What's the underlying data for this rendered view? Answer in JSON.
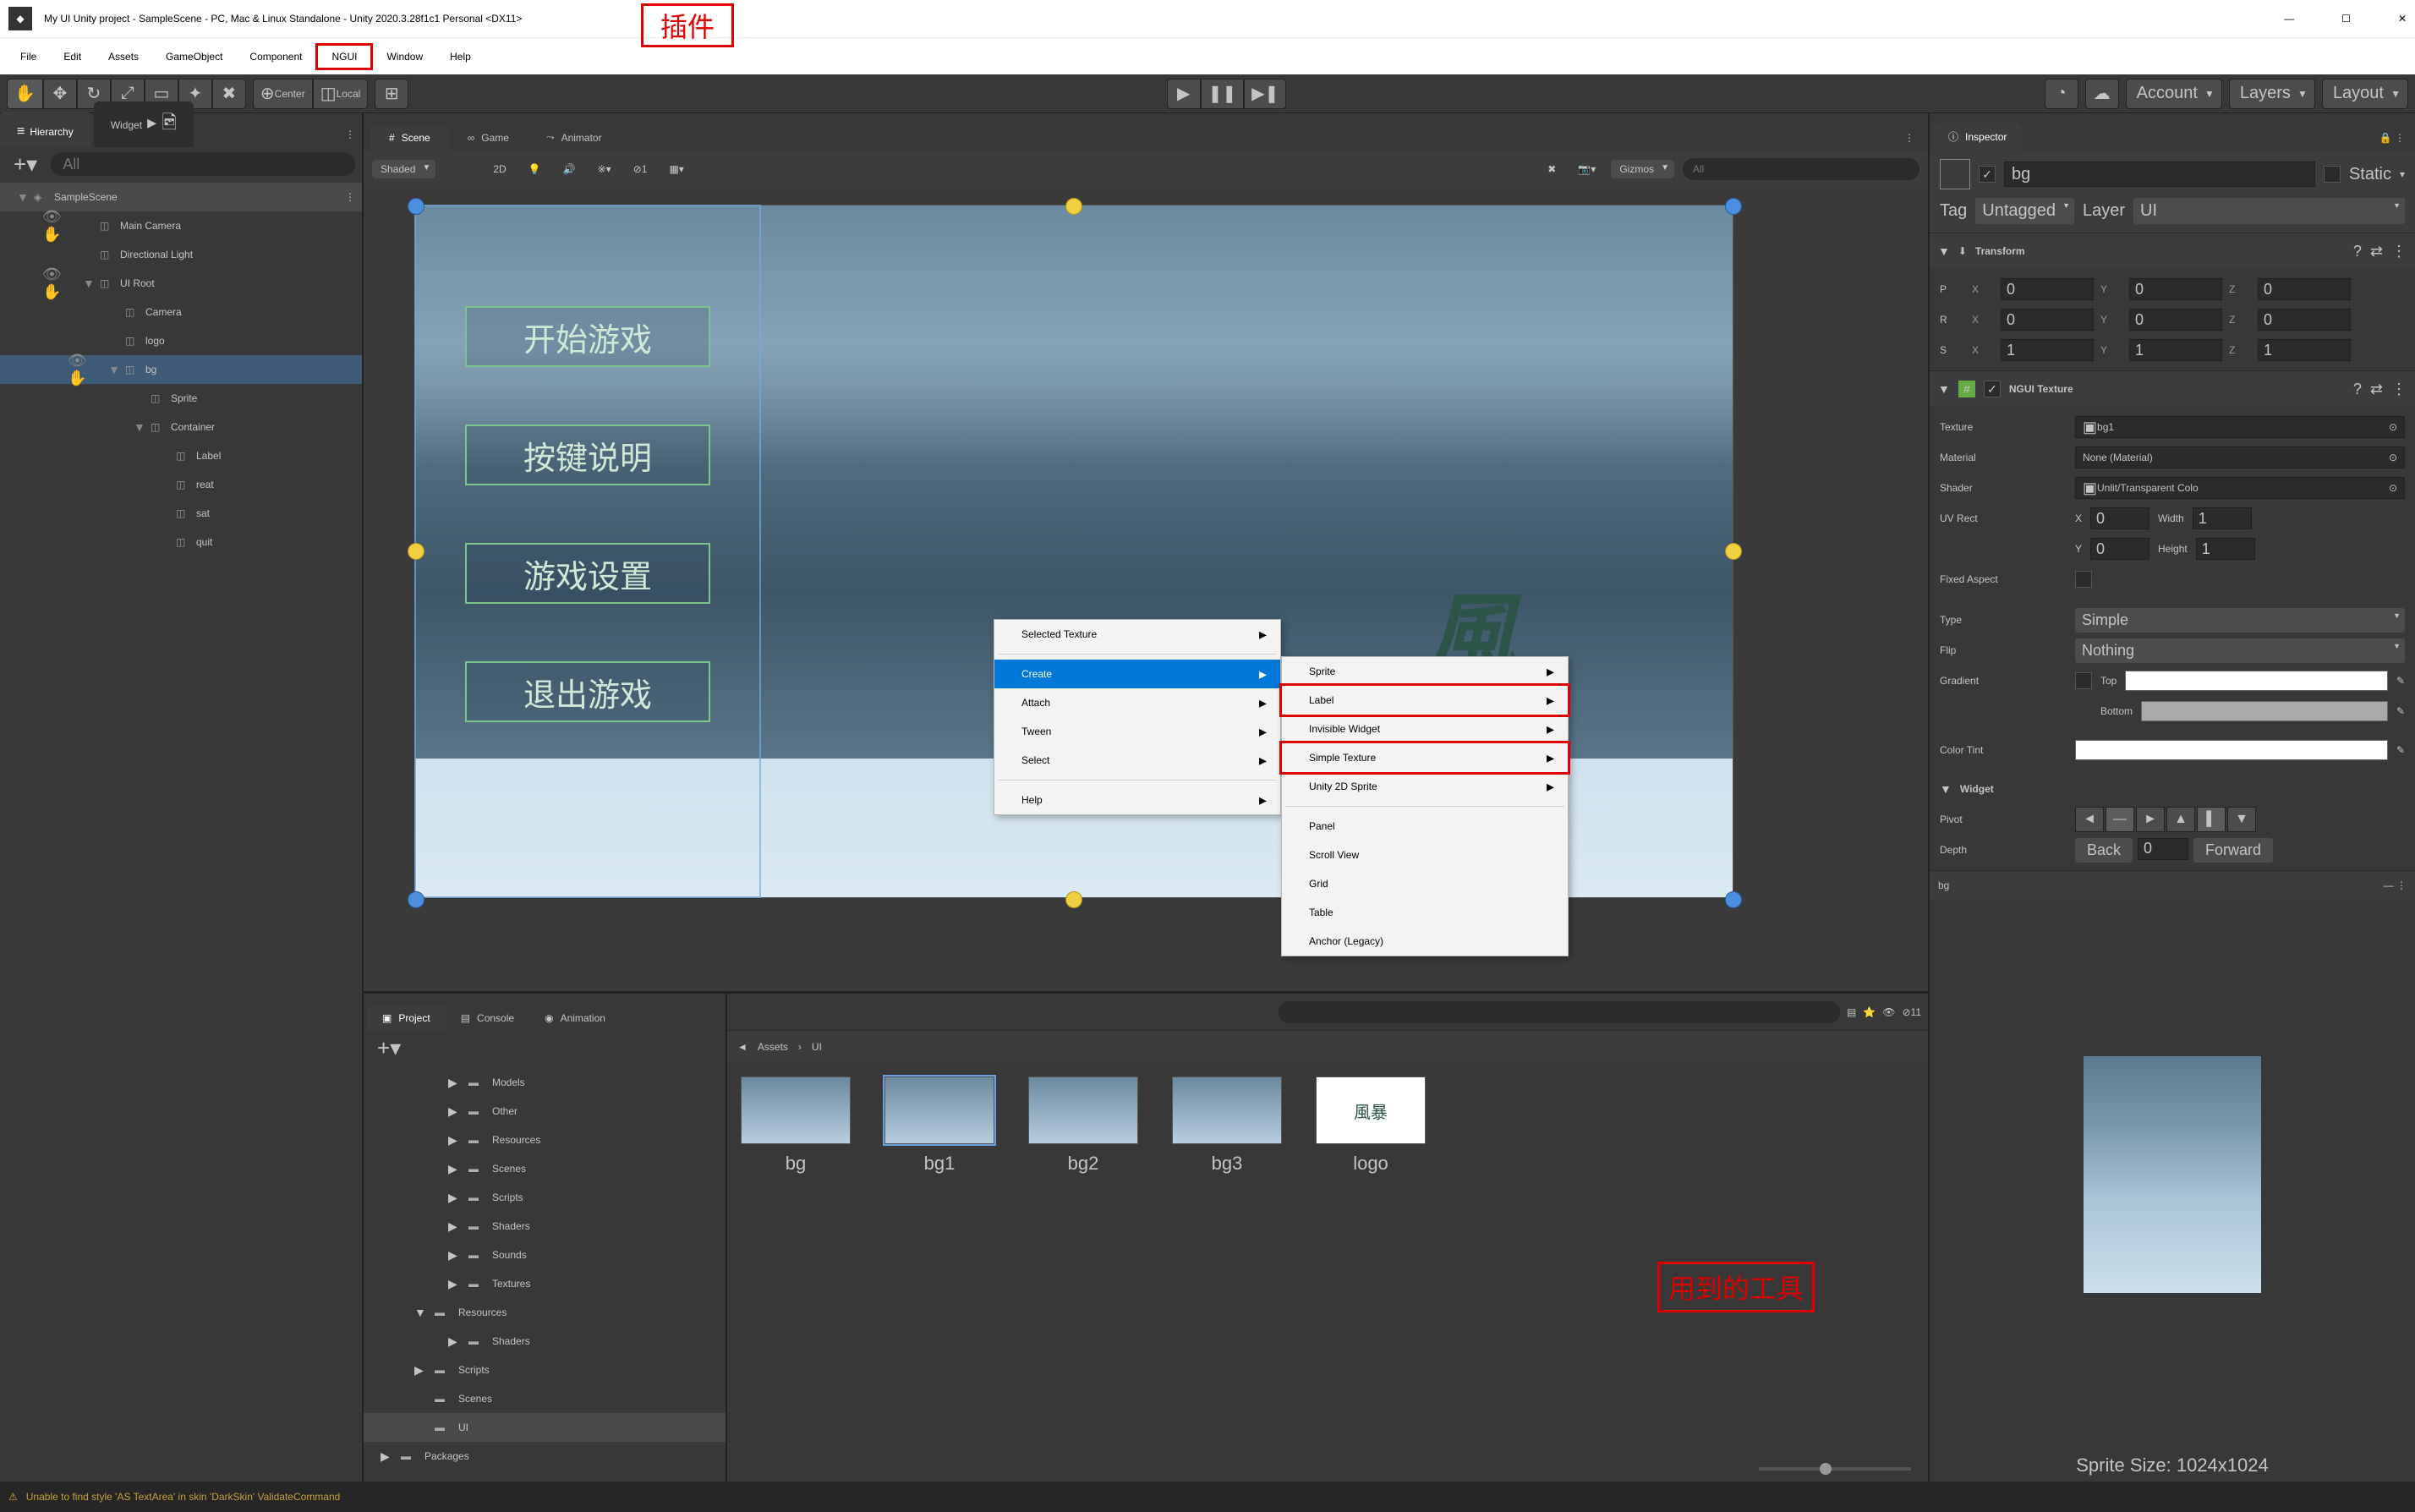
{
  "title": "My UI Unity project - SampleScene - PC, Mac & Linux Standalone - Unity 2020.3.28f1c1 Personal <DX11>",
  "annotation_top": "插件",
  "menubar": [
    "File",
    "Edit",
    "Assets",
    "GameObject",
    "Component",
    "NGUI",
    "Window",
    "Help"
  ],
  "menubar_highlight": "NGUI",
  "toolbar": {
    "center": "Center",
    "local": "Local",
    "account": "Account",
    "layers": "Layers",
    "layout": "Layout"
  },
  "hierarchy": {
    "title": "Hierarchy",
    "widget_tab": "Widget",
    "search_placeholder": "All",
    "scene": "SampleScene",
    "nodes": [
      {
        "name": "Main Camera",
        "ind": 1
      },
      {
        "name": "Directional Light",
        "ind": 1
      },
      {
        "name": "UI Root",
        "ind": 1,
        "exp": true
      },
      {
        "name": "Camera",
        "ind": 2
      },
      {
        "name": "logo",
        "ind": 2
      },
      {
        "name": "bg",
        "ind": 2,
        "exp": true,
        "sel": true
      },
      {
        "name": "Sprite",
        "ind": 3
      },
      {
        "name": "Container",
        "ind": 3,
        "exp": true
      },
      {
        "name": "Label",
        "ind": 4
      },
      {
        "name": "reat",
        "ind": 4
      },
      {
        "name": "sat",
        "ind": 4
      },
      {
        "name": "quit",
        "ind": 4
      }
    ]
  },
  "scene_tabs": {
    "scene": "Scene",
    "game": "Game",
    "animator": "Animator"
  },
  "scene_toolbar": {
    "shaded": "Shaded",
    "twod": "2D",
    "gizmos": "Gizmos",
    "search_placeholder": "All"
  },
  "menu_buttons": [
    "开始游戏",
    "按键说明",
    "游戏设置",
    "退出游戏"
  ],
  "context1": [
    {
      "label": "Selected Texture",
      "arrow": true
    },
    {
      "sep": true
    },
    {
      "label": "Create",
      "arrow": true,
      "sel": true
    },
    {
      "label": "Attach",
      "arrow": true
    },
    {
      "label": "Tween",
      "arrow": true
    },
    {
      "label": "Select",
      "arrow": true
    },
    {
      "sep": true
    },
    {
      "label": "Help",
      "arrow": true
    }
  ],
  "context2": [
    {
      "label": "Sprite",
      "arrow": true
    },
    {
      "label": "Label",
      "arrow": true,
      "hl": true
    },
    {
      "label": "Invisible Widget",
      "arrow": true
    },
    {
      "label": "Simple Texture",
      "arrow": true,
      "hl": true
    },
    {
      "label": "Unity 2D Sprite",
      "arrow": true
    },
    {
      "sep": true
    },
    {
      "label": "Panel"
    },
    {
      "label": "Scroll View"
    },
    {
      "label": "Grid"
    },
    {
      "label": "Table"
    },
    {
      "label": "Anchor (Legacy)"
    }
  ],
  "annotation_tools": "用到的工具",
  "project": {
    "tab_project": "Project",
    "tab_console": "Console",
    "tab_animation": "Animation",
    "tree": [
      {
        "name": "Models",
        "ind": 2,
        "tri": "▶"
      },
      {
        "name": "Other",
        "ind": 2,
        "tri": "▶"
      },
      {
        "name": "Resources",
        "ind": 2,
        "tri": "▶"
      },
      {
        "name": "Scenes",
        "ind": 2,
        "tri": "▶"
      },
      {
        "name": "Scripts",
        "ind": 2,
        "tri": "▶"
      },
      {
        "name": "Shaders",
        "ind": 2,
        "tri": "▶"
      },
      {
        "name": "Sounds",
        "ind": 2,
        "tri": "▶"
      },
      {
        "name": "Textures",
        "ind": 2,
        "tri": "▶"
      },
      {
        "name": "Resources",
        "ind": 1,
        "tri": "▼"
      },
      {
        "name": "Shaders",
        "ind": 2,
        "tri": "▶"
      },
      {
        "name": "Scripts",
        "ind": 1,
        "tri": "▶"
      },
      {
        "name": "Scenes",
        "ind": 1,
        "tri": ""
      },
      {
        "name": "UI",
        "ind": 1,
        "tri": "",
        "sel": true
      },
      {
        "name": "Packages",
        "ind": 0,
        "tri": "▶"
      }
    ],
    "breadcrumb": [
      "Assets",
      "UI"
    ],
    "assets": [
      {
        "name": "bg"
      },
      {
        "name": "bg1",
        "sel": true
      },
      {
        "name": "bg2"
      },
      {
        "name": "bg3"
      },
      {
        "name": "logo",
        "logo": true
      }
    ]
  },
  "inspector": {
    "title": "Inspector",
    "name": "bg",
    "static": "Static",
    "tag_lbl": "Tag",
    "tag_val": "Untagged",
    "layer_lbl": "Layer",
    "layer_val": "UI",
    "transform": {
      "title": "Transform",
      "P": {
        "X": "0",
        "Y": "0",
        "Z": "0"
      },
      "R": {
        "X": "0",
        "Y": "0",
        "Z": "0"
      },
      "S": {
        "X": "1",
        "Y": "1",
        "Z": "1"
      }
    },
    "ngui": {
      "title": "NGUI Texture",
      "texture_lbl": "Texture",
      "texture_val": "bg1",
      "material_lbl": "Material",
      "material_val": "None (Material)",
      "shader_lbl": "Shader",
      "shader_val": "Unlit/Transparent Colo",
      "uvrect_lbl": "UV Rect",
      "uv_x_lbl": "X",
      "uv_x": "0",
      "uv_w_lbl": "Width",
      "uv_w": "1",
      "uv_y_lbl": "Y",
      "uv_y": "0",
      "uv_h_lbl": "Height",
      "uv_h": "1",
      "fixed_lbl": "Fixed Aspect",
      "type_lbl": "Type",
      "type_val": "Simple",
      "flip_lbl": "Flip",
      "flip_val": "Nothing",
      "gradient_lbl": "Gradient",
      "gradient_top": "Top",
      "gradient_bottom": "Bottom",
      "colortint_lbl": "Color Tint",
      "widget_lbl": "Widget",
      "pivot_lbl": "Pivot",
      "depth_lbl": "Depth",
      "depth_back": "Back",
      "depth_val": "0",
      "depth_fwd": "Forward"
    },
    "preview_name": "bg",
    "preview_size": "Sprite Size: 1024x1024"
  },
  "status": {
    "msg": "Unable to find style 'AS TextArea' in skin 'DarkSkin' ValidateCommand"
  },
  "tool_count": "11"
}
